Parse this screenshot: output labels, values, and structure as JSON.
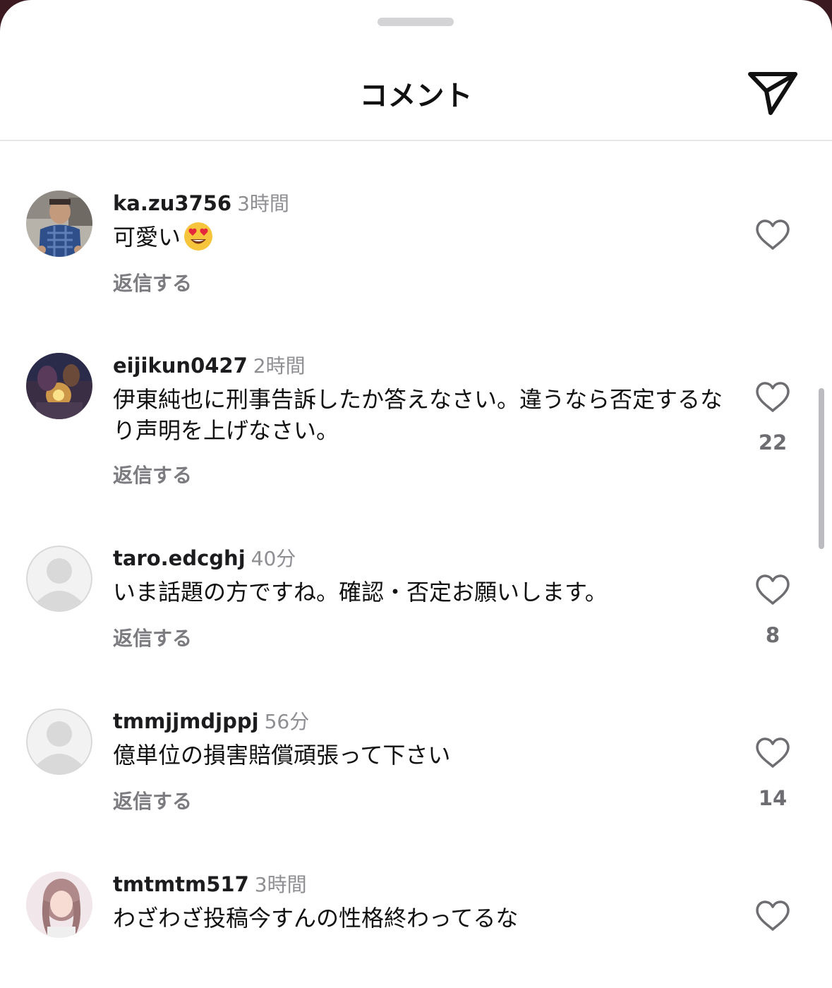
{
  "header": {
    "title": "コメント",
    "share_icon": "paper-plane-icon"
  },
  "comments": [
    {
      "username": "ka.zu3756",
      "time": "3時間",
      "text": "可愛い",
      "emoji": "heart-eyes-emoji",
      "reply_label": "返信する",
      "likes": ""
    },
    {
      "username": "eijikun0427",
      "time": "2時間",
      "text": "伊東純也に刑事告訴したか答えなさい。違うなら否定するなり声明を上げなさい。",
      "reply_label": "返信する",
      "likes": "22"
    },
    {
      "username": "taro.edcghj",
      "time": "40分",
      "text": "いま話題の方ですね。確認・否定お願いします。",
      "reply_label": "返信する",
      "likes": "8"
    },
    {
      "username": "tmmjjmdjppj",
      "time": "56分",
      "text": "億単位の損害賠償頑張って下さい",
      "reply_label": "返信する",
      "likes": "14"
    },
    {
      "username": "tmtmtm517",
      "time": "3時間",
      "text": "わざわざ投稿今すんの性格終わってるな",
      "reply_label": "",
      "likes": ""
    }
  ],
  "colors": {
    "background_outer": "#3b1a22",
    "sheet": "#ffffff",
    "text_primary": "#111111",
    "text_secondary": "#8e8e93",
    "divider": "#e6e6e8"
  }
}
